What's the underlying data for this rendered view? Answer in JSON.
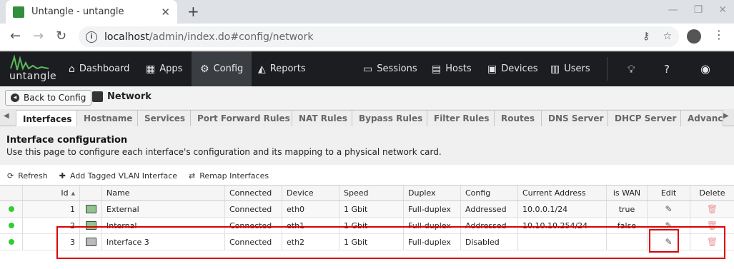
{
  "browser": {
    "tab_title": "Untangle - untangle",
    "url_host": "localhost",
    "url_path": "/admin/index.do#config/network"
  },
  "nav": {
    "logo": "untangle",
    "items": [
      {
        "label": "Dashboard",
        "icon": "home-icon"
      },
      {
        "label": "Apps",
        "icon": "grid-icon"
      },
      {
        "label": "Config",
        "icon": "gear-icon"
      },
      {
        "label": "Reports",
        "icon": "chart-icon"
      },
      {
        "label": "Sessions",
        "icon": "sessions-icon"
      },
      {
        "label": "Hosts",
        "icon": "hosts-icon"
      },
      {
        "label": "Devices",
        "icon": "devices-icon"
      },
      {
        "label": "Users",
        "icon": "users-icon"
      }
    ],
    "active": "Config"
  },
  "page": {
    "back_label": "Back to Config",
    "title": "Network"
  },
  "subtabs": [
    "Interfaces",
    "Hostname",
    "Services",
    "Port Forward Rules",
    "NAT Rules",
    "Bypass Rules",
    "Filter Rules",
    "Routes",
    "DNS Server",
    "DHCP Server",
    "Advanc"
  ],
  "active_subtab": "Interfaces",
  "config": {
    "heading": "Interface configuration",
    "description": "Use this page to configure each interface's configuration and its mapping to a physical network card."
  },
  "toolbar": {
    "refresh": "Refresh",
    "add_vlan": "Add Tagged VLAN Interface",
    "remap": "Remap Interfaces"
  },
  "grid": {
    "headers": [
      "Id",
      "Name",
      "Connected",
      "Device",
      "Speed",
      "Duplex",
      "Config",
      "Current Address",
      "is WAN",
      "Edit",
      "Delete"
    ],
    "rows": [
      {
        "id": "1",
        "name": "External",
        "connected": "Connected",
        "device": "eth0",
        "speed": "1 Gbit",
        "duplex": "Full-duplex",
        "config": "Addressed",
        "address": "10.0.0.1/24",
        "wan": "true"
      },
      {
        "id": "2",
        "name": "Internal",
        "connected": "Connected",
        "device": "eth1",
        "speed": "1 Gbit",
        "duplex": "Full-duplex",
        "config": "Addressed",
        "address": "10.10.10.254/24",
        "wan": "false"
      },
      {
        "id": "3",
        "name": "Interface 3",
        "connected": "Connected",
        "device": "eth2",
        "speed": "1 Gbit",
        "duplex": "Full-duplex",
        "config": "Disabled",
        "address": "",
        "wan": ""
      }
    ]
  },
  "colors": {
    "appbar": "#1b1d21",
    "status_connected": "#33cc33",
    "highlight": "#dd0000"
  }
}
